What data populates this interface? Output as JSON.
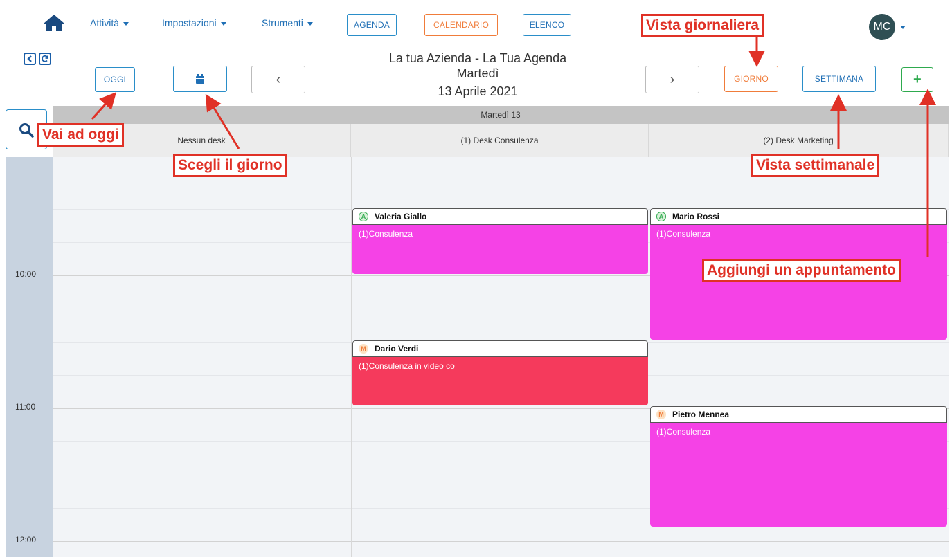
{
  "nav": {
    "home_icon": "home-icon",
    "menus": [
      "Attività",
      "Impostazioni",
      "Strumenti"
    ],
    "view_buttons": [
      "AGENDA",
      "CALENDARIO",
      "ELENCO"
    ],
    "user_initials": "MC"
  },
  "toolbar": {
    "today_label": "OGGI",
    "calendar_icon": "calendar-icon",
    "prev_label": "‹",
    "next_label": "›",
    "day_label": "GIORNO",
    "week_label": "SETTIMANA",
    "add_label": "+",
    "collapse_icon": "chevron-left-icon",
    "refresh_icon": "refresh-icon",
    "search_icon": "search-icon"
  },
  "title": {
    "line1": "La tua Azienda - La Tua Agenda",
    "line2": "Martedì",
    "line3": "13 Aprile 2021"
  },
  "calendar": {
    "day_header": "Martedì 13",
    "desks": [
      "Nessun desk",
      "(1) Desk Consulenza",
      "(2) Desk Marketing"
    ],
    "time_labels": [
      "10:00",
      "11:00",
      "12:00"
    ],
    "appointments": [
      {
        "name": "Valeria Giallo",
        "badge": "A",
        "service": "(1)Consulenza",
        "start": "09:30",
        "end": "10:00",
        "color": "#f542e6"
      },
      {
        "name": "Mario Rossi",
        "badge": "A",
        "service": "(1)Consulenza",
        "start": "09:30",
        "end": "10:30",
        "color": "#f542e6"
      },
      {
        "name": "Dario Verdi",
        "badge": "M",
        "service": "(1)Consulenza in video co",
        "start": "10:30",
        "end": "11:00",
        "color": "#f53a5c"
      },
      {
        "name": "Pietro Mennea",
        "badge": "M",
        "service": "(1)Consulenza",
        "start": "11:00",
        "end": "12:00",
        "color": "#f542e6"
      }
    ]
  },
  "annotations": {
    "vai_ad_oggi": "Vai ad oggi",
    "scegli_giorno": "Scegli il giorno",
    "vista_giornaliera": "Vista giornaliera",
    "vista_settimanale": "Vista settimanale",
    "aggiungi": "Aggiungi un appuntamento"
  },
  "colors": {
    "primary": "#1f6fb5",
    "accent_orange": "#f07c3a",
    "accent_green": "#2eaa4e",
    "annotation_red": "#e03126",
    "appointment_pink": "#f542e6",
    "appointment_red": "#f53a5c"
  }
}
